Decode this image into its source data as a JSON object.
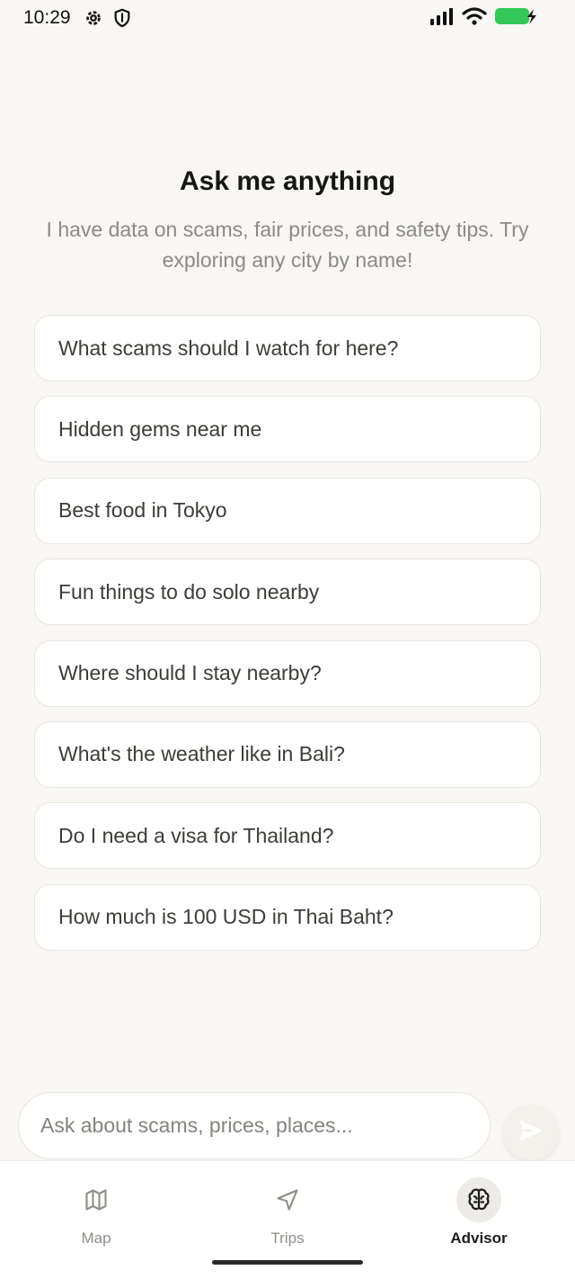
{
  "status_bar": {
    "time": "10:29"
  },
  "heading": "Ask me anything",
  "subtitle": "I have data on scams, fair prices, and safety tips. Try exploring any city by name!",
  "suggestions": [
    "What scams should I watch for here?",
    "Hidden gems near me",
    "Best food in Tokyo",
    "Fun things to do solo nearby",
    "Where should I stay nearby?",
    "What's the weather like in Bali?",
    "Do I need a visa for Thailand?",
    "How much is 100 USD in Thai Baht?"
  ],
  "chat_input": {
    "value": "",
    "placeholder": "Ask about scams, prices, places..."
  },
  "tabs": [
    {
      "label": "Map",
      "icon": "map-icon",
      "active": false
    },
    {
      "label": "Trips",
      "icon": "navigation-arrow-icon",
      "active": false
    },
    {
      "label": "Advisor",
      "icon": "brain-icon",
      "active": true
    }
  ],
  "colors": {
    "background": "#f8f7f4",
    "battery": "#34c759",
    "card_border": "#e6e5e0"
  }
}
